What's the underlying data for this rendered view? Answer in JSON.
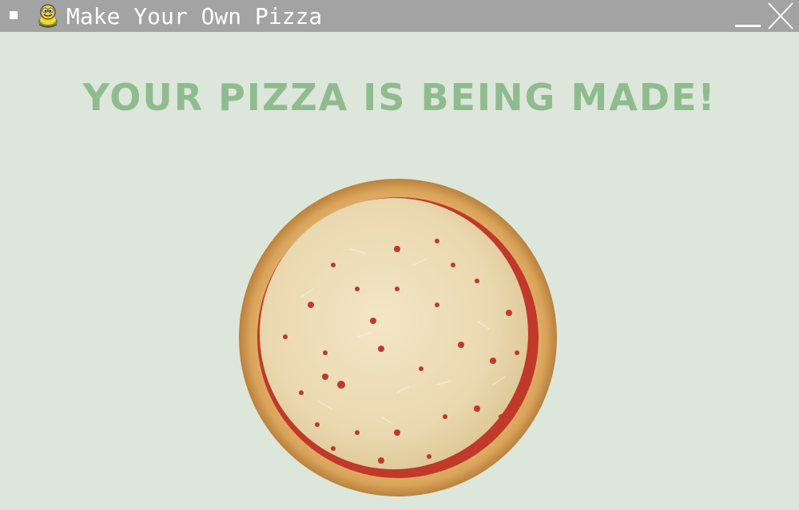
{
  "window": {
    "title": "Make Your Own Pizza",
    "icons": {
      "system_menu": "window-menu-icon",
      "app": "pygame-snake-icon",
      "minimize": "minimize-icon",
      "close": "close-icon"
    },
    "colors": {
      "titlebar": "#a3a3a3",
      "background": "#dde6da"
    }
  },
  "main": {
    "headline": "YOUR PIZZA IS BEING MADE!",
    "headline_color": "#8fbc8f",
    "image": "cheese-pizza-image"
  }
}
